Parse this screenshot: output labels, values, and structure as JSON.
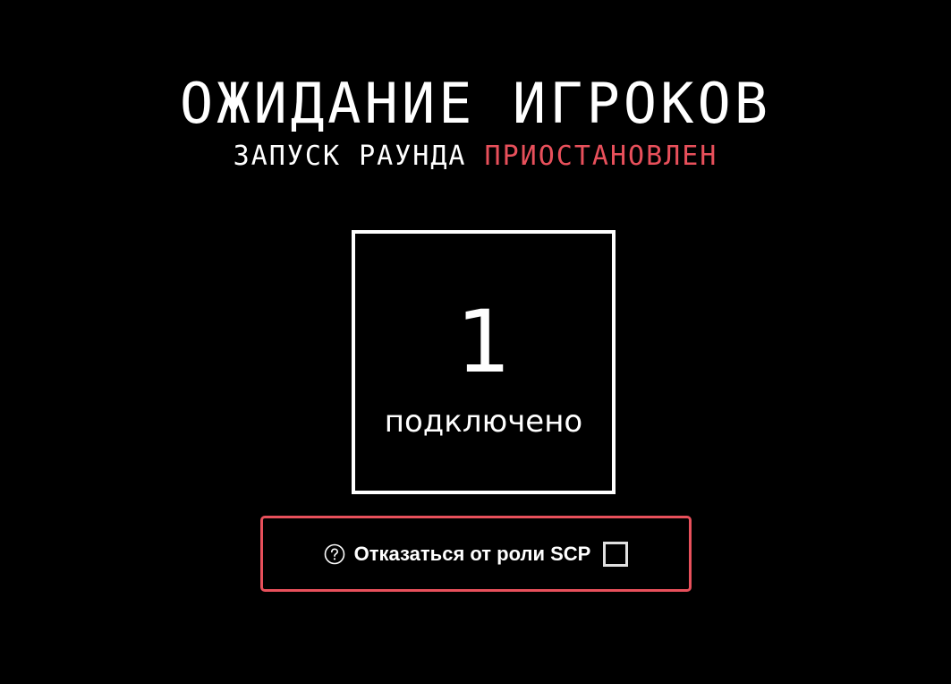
{
  "lobby": {
    "title": "ОЖИДАНИЕ ИГРОКОВ",
    "subtitle_lead": "ЗАПУСК РАУНДА",
    "subtitle_status": "ПРИОСТАНОВЛЕН",
    "status_color": "#e8505b"
  },
  "counter": {
    "value": "1",
    "label": "подключено"
  },
  "optout": {
    "icon": "question-circle-icon",
    "label": "Отказаться от роли SCP",
    "checked": false,
    "accent_color": "#e8505b"
  }
}
